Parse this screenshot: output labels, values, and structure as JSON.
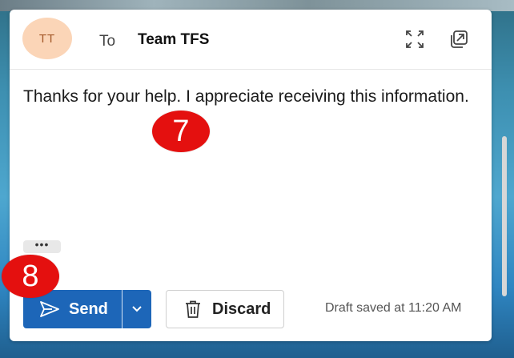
{
  "compose": {
    "avatar_initials": "TT",
    "to_label": "To",
    "recipient": "Team TFS",
    "body": "Thanks for your help.  I appreciate receiving this information.",
    "more_options_label": "•••",
    "send_label": "Send",
    "discard_label": "Discard",
    "draft_status": "Draft saved at 11:20 AM"
  },
  "annotations": {
    "step_7": "7",
    "step_8": "8"
  },
  "icons": {
    "expand": "expand-icon",
    "popout": "popout-icon",
    "send": "send-icon",
    "dropdown": "chevron-down-icon",
    "discard": "trash-icon"
  },
  "colors": {
    "send_button": "#1d66b8",
    "avatar_bg": "#fbd5b7",
    "avatar_text": "#a45a2a",
    "annotation_marker": "#e4100f"
  }
}
